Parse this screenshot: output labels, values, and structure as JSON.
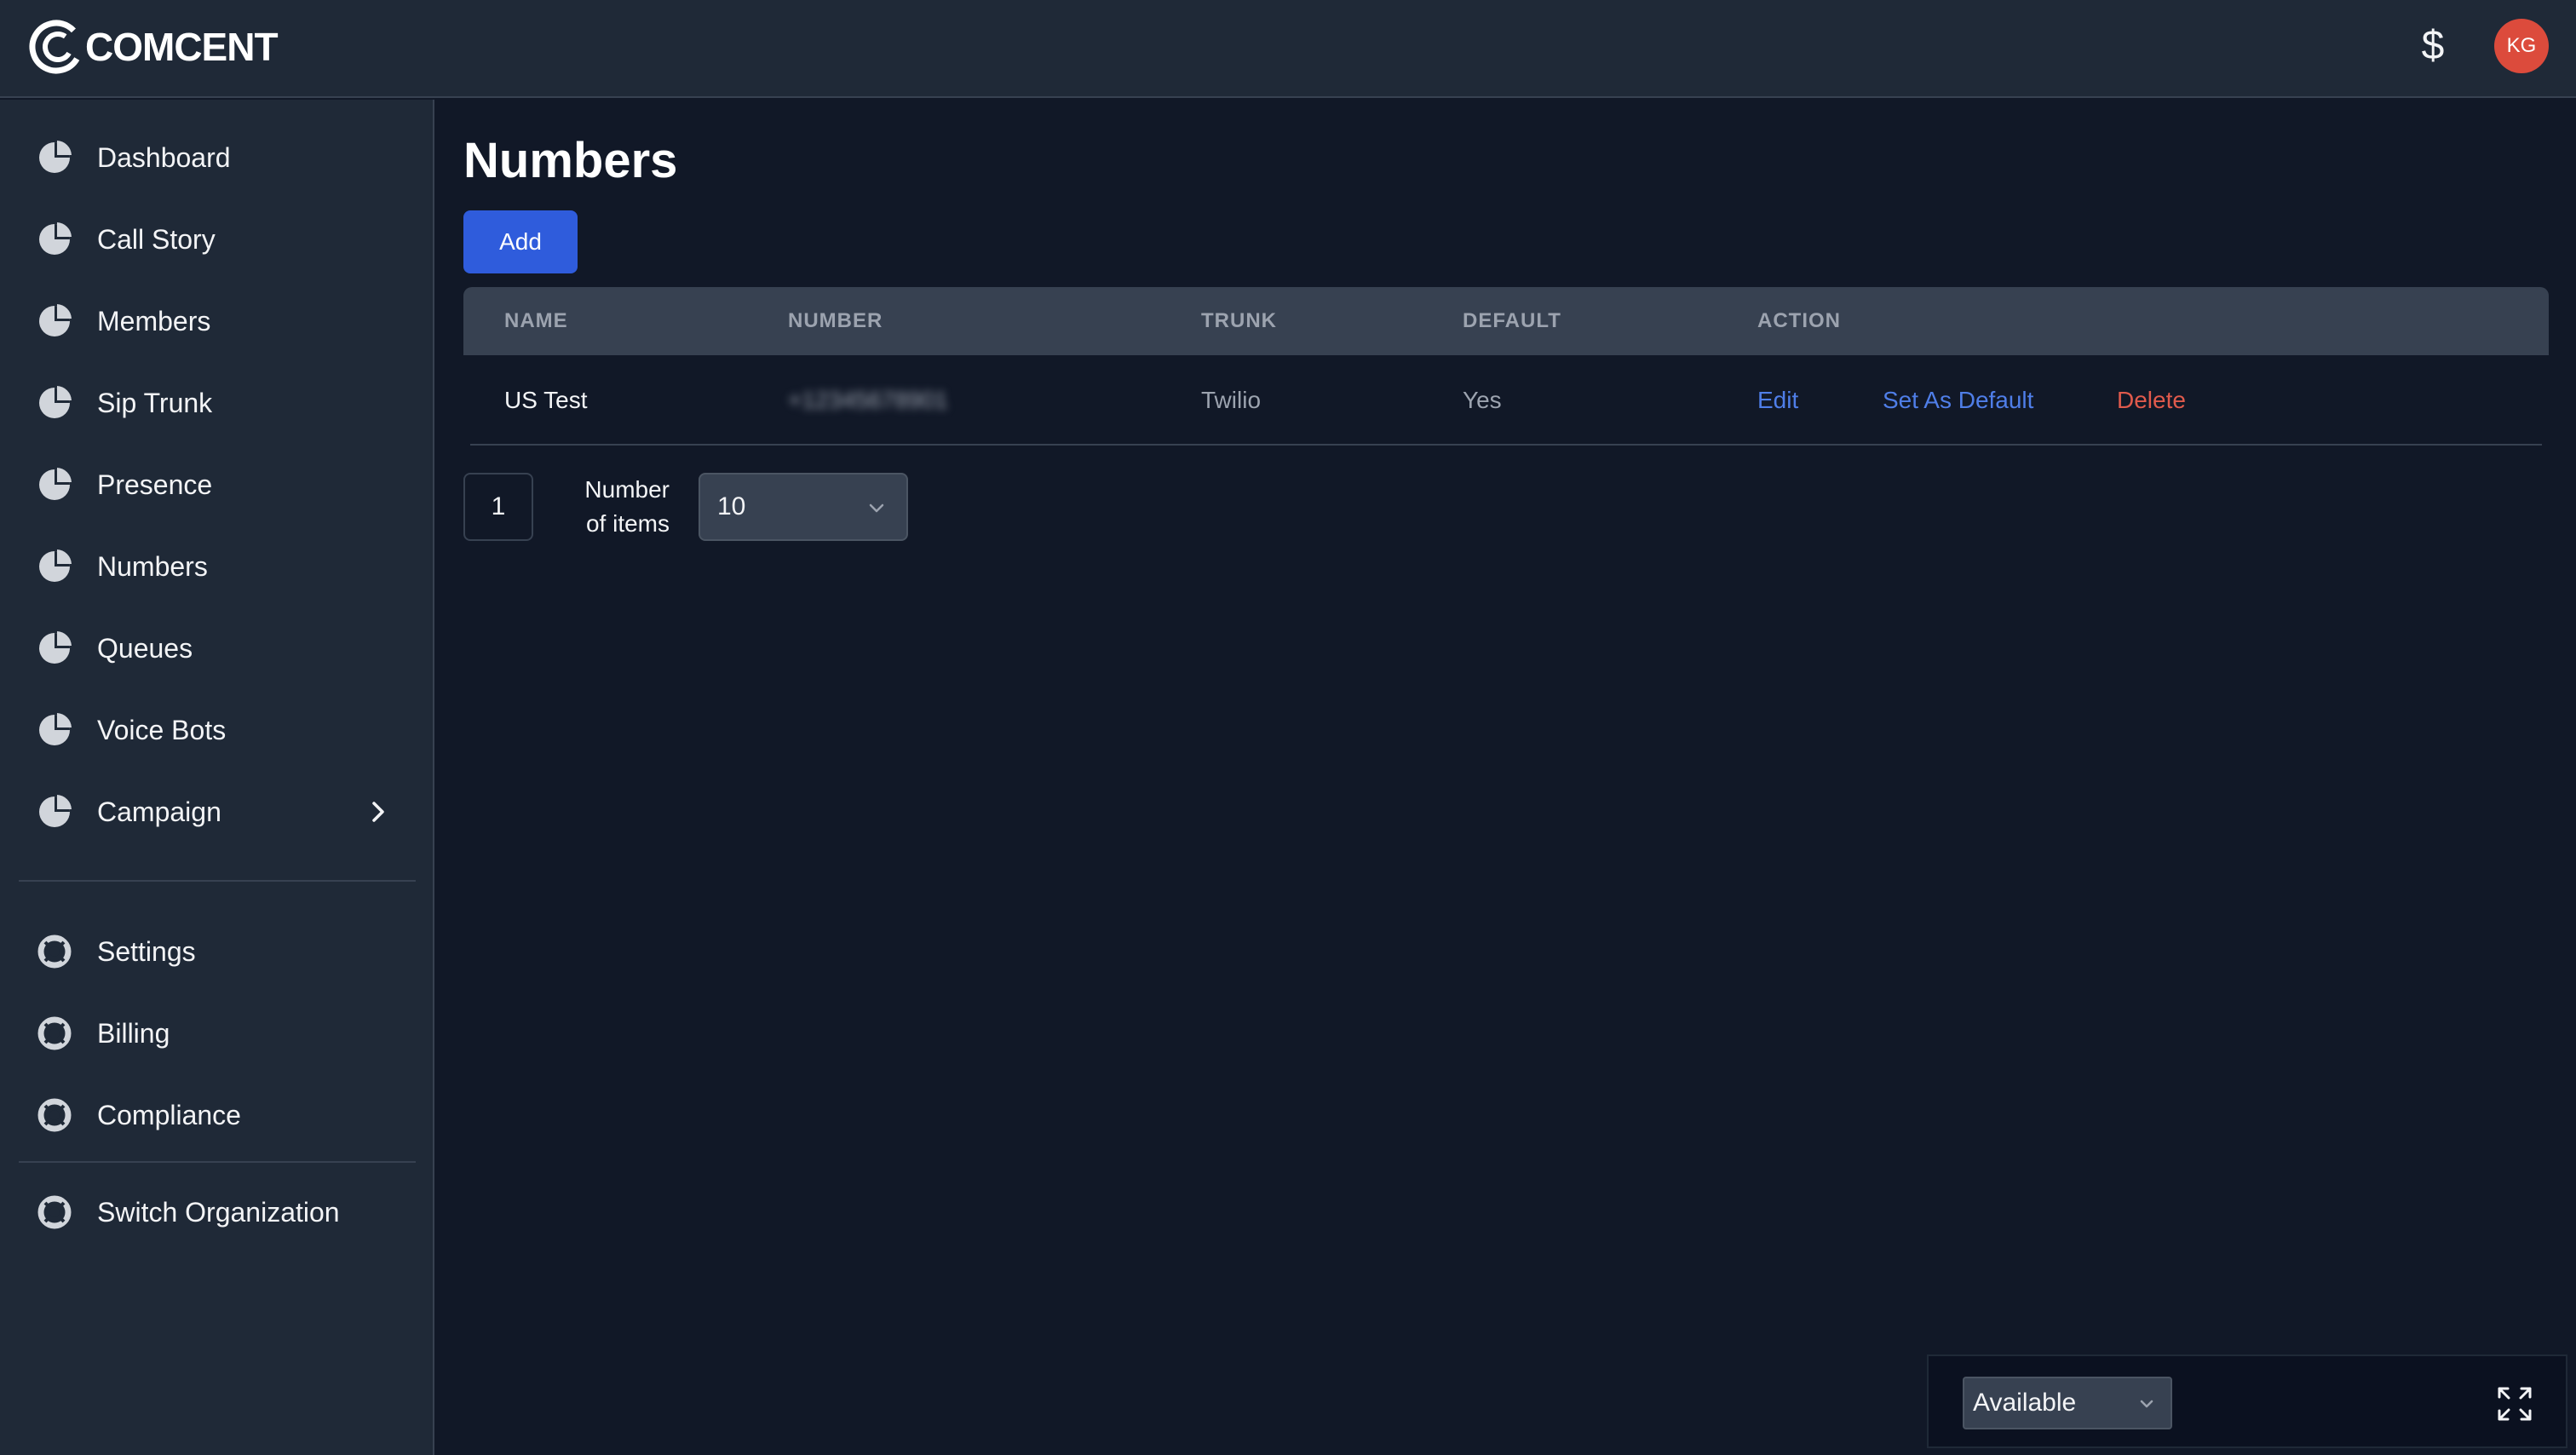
{
  "app": {
    "brand": "COMCENT",
    "currency_icon": "$",
    "avatar_initials": "KG",
    "avatar_color": "#dc4b3c"
  },
  "sidebar": {
    "main_items": [
      {
        "label": "Dashboard",
        "icon": "pie-chart-icon"
      },
      {
        "label": "Call Story",
        "icon": "pie-chart-icon"
      },
      {
        "label": "Members",
        "icon": "pie-chart-icon"
      },
      {
        "label": "Sip Trunk",
        "icon": "pie-chart-icon"
      },
      {
        "label": "Presence",
        "icon": "pie-chart-icon"
      },
      {
        "label": "Numbers",
        "icon": "pie-chart-icon"
      },
      {
        "label": "Queues",
        "icon": "pie-chart-icon"
      },
      {
        "label": "Voice Bots",
        "icon": "pie-chart-icon"
      },
      {
        "label": "Campaign",
        "icon": "pie-chart-icon",
        "has_submenu": true
      }
    ],
    "settings_items": [
      {
        "label": "Settings",
        "icon": "lifebuoy-icon"
      },
      {
        "label": "Billing",
        "icon": "lifebuoy-icon"
      },
      {
        "label": "Compliance",
        "icon": "lifebuoy-icon"
      }
    ],
    "org_items": [
      {
        "label": "Switch Organization",
        "icon": "lifebuoy-icon"
      }
    ]
  },
  "main": {
    "title": "Numbers",
    "add_label": "Add",
    "table": {
      "headers": [
        "NAME",
        "NUMBER",
        "TRUNK",
        "DEFAULT",
        "ACTION"
      ],
      "rows": [
        {
          "name": "US Test",
          "number": "+12345678901",
          "trunk": "Twilio",
          "default": "Yes",
          "actions": [
            "Edit",
            "Set As Default",
            "Delete"
          ]
        }
      ]
    },
    "pagination": {
      "current_page": "1",
      "items_label": "Number of items",
      "items_per_page": "10"
    }
  },
  "status": {
    "value": "Available"
  },
  "colors": {
    "primary": "#2f5cdc",
    "link": "#4f7ee8",
    "danger": "#e05a4c"
  }
}
